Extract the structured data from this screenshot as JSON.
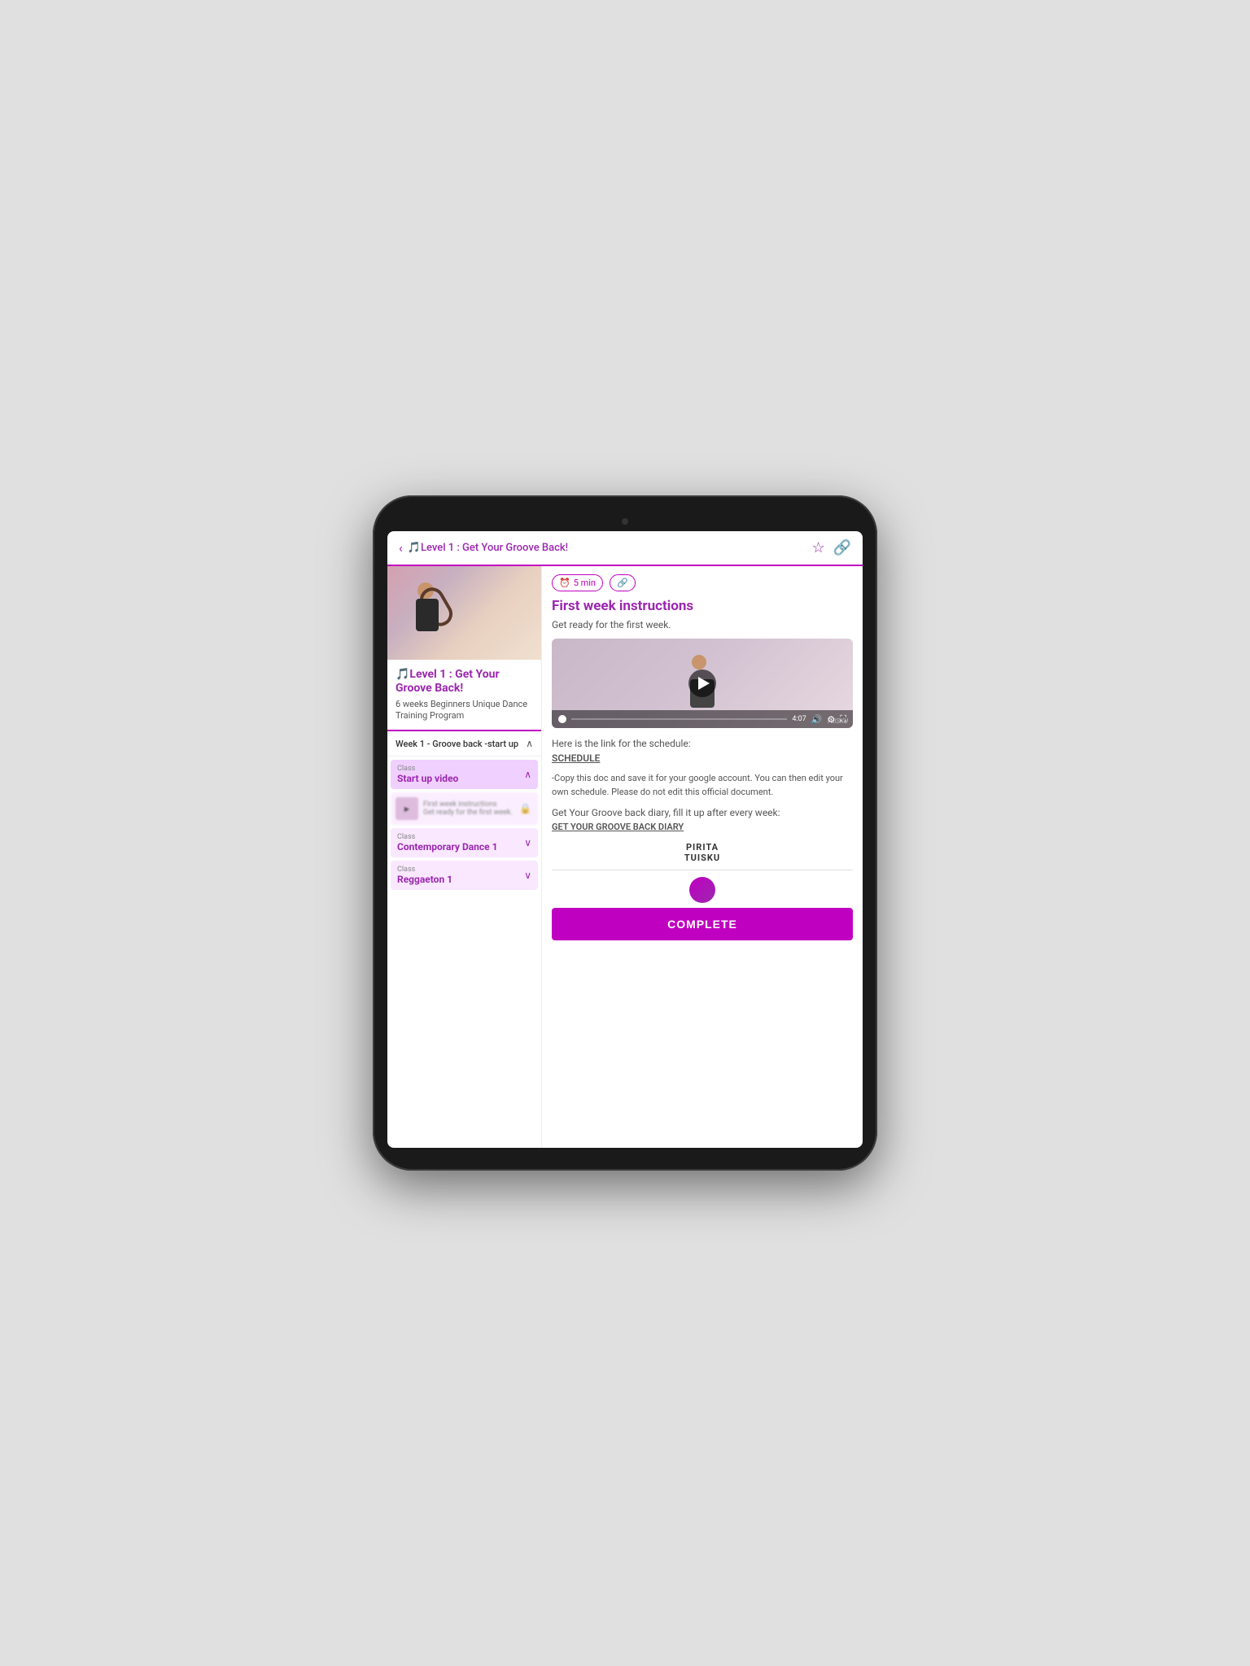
{
  "tablet": {
    "camera_aria": "tablet-camera"
  },
  "header": {
    "back_label": "‹",
    "title": "🎵Level 1 : Get Your Groove Back!",
    "star_icon": "☆",
    "link_icon": "🔗"
  },
  "left_panel": {
    "program_title": "🎵Level 1 : Get Your Groove Back!",
    "program_subtitle": "6 weeks Beginners Unique Dance Training Program",
    "week_section": {
      "title": "Week 1 - Groove back -start up",
      "chevron": "∧"
    },
    "classes": [
      {
        "label": "Class",
        "name": "Start up video",
        "expanded": true
      },
      {
        "label": "Class",
        "name": "Contemporary Dance 1",
        "expanded": false
      },
      {
        "label": "Class",
        "name": "Reggaeton 1",
        "expanded": false
      }
    ],
    "preview": {
      "title": "First week instructions",
      "subtitle": "Get ready for the first week.",
      "locked": true
    }
  },
  "right_panel": {
    "badges": [
      {
        "icon": "⏰",
        "text": "5 min"
      },
      {
        "icon": "🔗",
        "text": ""
      }
    ],
    "content_title": "First week instructions",
    "content_subtitle": "Get ready for the first week.",
    "video": {
      "duration": "4:07",
      "watermark": "TUISKU"
    },
    "schedule_label": "Here is the link for the schedule:",
    "schedule_link": "SCHEDULE",
    "schedule_description": "-Copy this doc and save it for your google account. You can then edit your own schedule. Please do not edit this official document.",
    "diary_label": "Get Your Groove back diary, fill it up after every week:",
    "diary_link": "GET YOUR GROOVE BACK DIARY",
    "brand_line1": "PIRITA",
    "brand_line2": "TUISKU",
    "complete_label": "COMPLETE"
  }
}
